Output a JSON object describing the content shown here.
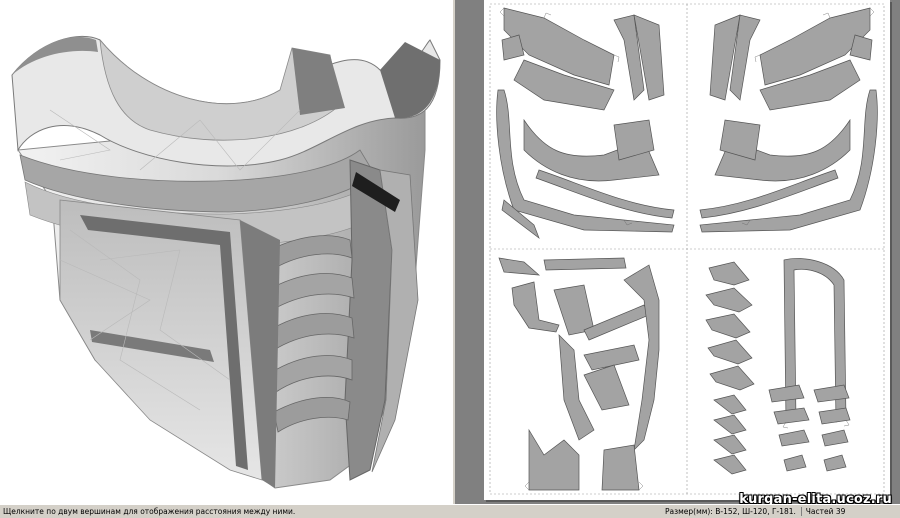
{
  "status_bar": {
    "hint": "Щелкните по двум вершинам для отображения расстояния между ними.",
    "size_info": "Размер(мм): В-152, Ш-120, Г-181.",
    "parts_count": "Частей 39"
  },
  "watermark": {
    "text": "kurgan-elita.ucoz.ru"
  },
  "colors": {
    "window_chrome": "#d4d0c8",
    "workspace_background": "#808080",
    "paper": "#ffffff",
    "part_fill": "#9e9e9e",
    "fold_lines": "#555555"
  }
}
